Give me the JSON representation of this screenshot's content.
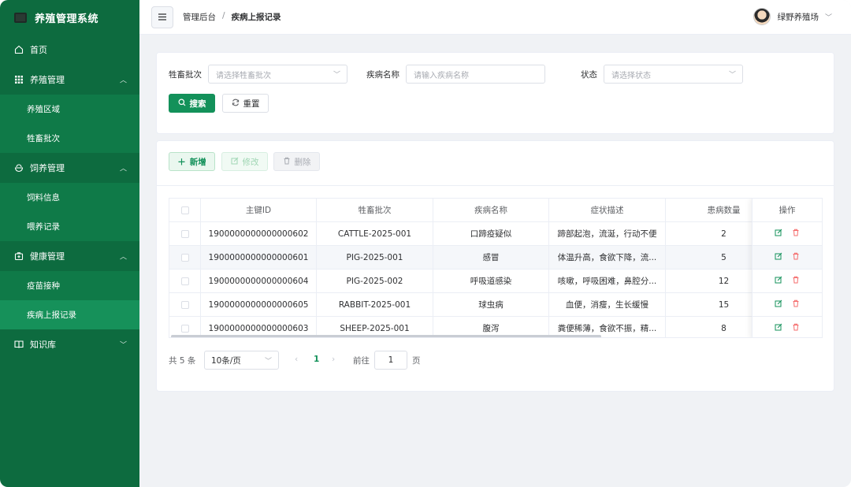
{
  "app": {
    "title": "养殖管理系统"
  },
  "sidebar": {
    "items": [
      {
        "label": "首页",
        "icon": "home-icon"
      },
      {
        "label": "养殖管理",
        "icon": "grid-icon",
        "children": [
          "养殖区域",
          "牲畜批次"
        ]
      },
      {
        "label": "饲养管理",
        "icon": "bowl-icon",
        "children": [
          "饲料信息",
          "喂养记录"
        ]
      },
      {
        "label": "健康管理",
        "icon": "medkit-icon",
        "children": [
          "疫苗接种",
          "疾病上报记录"
        ]
      },
      {
        "label": "知识库",
        "icon": "book-icon"
      }
    ],
    "active_child": "疾病上报记录"
  },
  "header": {
    "breadcrumb": [
      "管理后台",
      "疾病上报记录"
    ],
    "user_name": "绿野养殖场"
  },
  "search": {
    "batch_label": "牲畜批次",
    "batch_placeholder": "请选择牲畜批次",
    "disease_label": "疾病名称",
    "disease_placeholder": "请输入疾病名称",
    "status_label": "状态",
    "status_placeholder": "请选择状态",
    "search_button": "搜索",
    "reset_button": "重置"
  },
  "toolbar": {
    "add": "新增",
    "edit": "修改",
    "delete": "删除"
  },
  "table": {
    "columns": [
      "主键ID",
      "牲畜批次",
      "疾病名称",
      "症状描述",
      "患病数量",
      "操作"
    ],
    "rows": [
      {
        "id": "1900000000000000602",
        "batch": "CATTLE-2025-001",
        "disease": "口蹄疫疑似",
        "symptom": "蹄部起泡，流涎，行动不便",
        "count": "2"
      },
      {
        "id": "1900000000000000601",
        "batch": "PIG-2025-001",
        "disease": "感冒",
        "symptom": "体温升高，食欲下降，流...",
        "count": "5"
      },
      {
        "id": "1900000000000000604",
        "batch": "PIG-2025-002",
        "disease": "呼吸道感染",
        "symptom": "咳嗽，呼吸困难，鼻腔分...",
        "count": "12"
      },
      {
        "id": "1900000000000000605",
        "batch": "RABBIT-2025-001",
        "disease": "球虫病",
        "symptom": "血便，消瘦，生长缓慢",
        "count": "15"
      },
      {
        "id": "1900000000000000603",
        "batch": "SHEEP-2025-001",
        "disease": "腹泻",
        "symptom": "粪便稀薄，食欲不振，精...",
        "count": "8"
      }
    ]
  },
  "pagination": {
    "total": "共 5 条",
    "page_size": "10条/页",
    "current_page": "1",
    "goto_label": "前往",
    "goto_value": "1",
    "page_suffix": "页"
  },
  "colors": {
    "sidebar": "#0d6b3f",
    "primary": "#13915a",
    "danger": "#f56c6c"
  }
}
